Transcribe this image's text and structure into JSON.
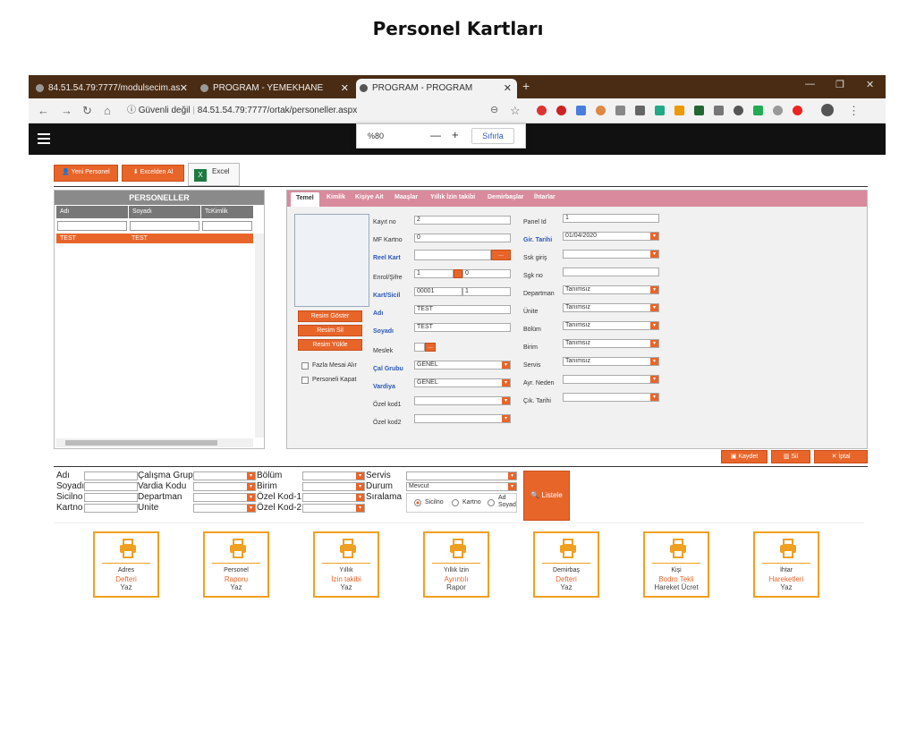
{
  "page_title": "Personel Kartları",
  "browser": {
    "tabs": [
      {
        "label": "84.51.54.79:7777/modulsecim.as"
      },
      {
        "label": "PROGRAM - YEMEKHANE"
      },
      {
        "label": "PROGRAM - PROGRAM"
      }
    ],
    "security": "Güvenli değil",
    "url": "84.51.54.79:7777/ortak/personeller.aspx",
    "zoom_value": "%80",
    "zoom_minus": "—",
    "zoom_plus": "+",
    "zoom_reset": "Sıfırla"
  },
  "toolbar": {
    "new": "Yeni Personel",
    "excel_import": "Excelden Al",
    "excel": "Excel"
  },
  "list": {
    "title": "PERSONELLER",
    "columns": [
      "Adı",
      "Soyadı",
      "TcKimlik"
    ],
    "rows": [
      {
        "adi": "TEST",
        "soyadi": "TEST",
        "tc": ""
      }
    ]
  },
  "detail_tabs": [
    "Temel",
    "Kimlik",
    "Kişiye Ait",
    "Maaşlar",
    "Yıllık İzin takibi",
    "Demirbaşlar",
    "İhtarlar"
  ],
  "photo_buttons": {
    "show": "Resim Göster",
    "delete": "Resim Sil",
    "upload": "Resim Yükle"
  },
  "checks": {
    "overtime": "Fazla Mesai Alır",
    "close": "Personeli Kapat"
  },
  "form": {
    "kayit_no": {
      "label": "Kayıt no",
      "value": "2"
    },
    "mf_kartno": {
      "label": "MF Kartno",
      "value": "0"
    },
    "reel_kart": {
      "label": "Reel Kart",
      "value": ""
    },
    "enrol": {
      "label": "Enrol/Şifre",
      "value1": "1",
      "value2": "0"
    },
    "kart_sicil": {
      "label": "Kart/Sicil",
      "value1": "00001",
      "value2": "1"
    },
    "adi": {
      "label": "Adı",
      "value": "TEST"
    },
    "soyadi": {
      "label": "Soyadı",
      "value": "TEST"
    },
    "meslek": {
      "label": "Meslek",
      "value": ""
    },
    "cal_grubu": {
      "label": "Çal Grubu",
      "value": "GENEL"
    },
    "vardiya": {
      "label": "Vardiya",
      "value": "GENEL"
    },
    "ozel_kod1": {
      "label": "Özel kod1",
      "value": ""
    },
    "ozel_kod2": {
      "label": "Özel kod2",
      "value": ""
    },
    "panel_id": {
      "label": "Panel Id",
      "value": "1"
    },
    "gir_tarihi": {
      "label": "Gir. Tarihi",
      "value": "01/04/2020"
    },
    "ssk_giris": {
      "label": "Ssk giriş",
      "value": ""
    },
    "sgk_no": {
      "label": "Sgk no",
      "value": ""
    },
    "departman": {
      "label": "Departman",
      "value": "Tanımsız"
    },
    "unite": {
      "label": "Ünite",
      "value": "Tanımsız"
    },
    "bolum": {
      "label": "Bölüm",
      "value": "Tanımsız"
    },
    "birim": {
      "label": "Birim",
      "value": "Tanımsız"
    },
    "servis": {
      "label": "Servis",
      "value": "Tanımsız"
    },
    "ayr_neden": {
      "label": "Ayr. Neden",
      "value": ""
    },
    "cik_tarihi": {
      "label": "Çık. Tarihi",
      "value": ""
    }
  },
  "actions": {
    "save": "Kaydet",
    "delete": "Sil",
    "cancel": "İptal"
  },
  "filter": {
    "adi": "Adı",
    "soyadi": "Soyadı",
    "sicilno": "Sicilno",
    "kartno": "Kartno",
    "calisma_grup": "Çalışma Grup",
    "vardia_kodu": "Vardia Kodu",
    "departman": "Departman",
    "unite": "Unite",
    "bolum": "Bölüm",
    "birim": "Birim",
    "ozel_kod1": "Özel Kod-1",
    "ozel_kod2": "Özel Kod-2",
    "servis": "Servis",
    "durum": "Durum",
    "durum_value": "Mevcut",
    "siralama": "Sıralama",
    "sort_sicilno": "Sicilno",
    "sort_kartno": "Kartno",
    "sort_ad": "Ad",
    "sort_soyad": "Soyad",
    "listele": "Listele"
  },
  "reports": [
    {
      "l1": "Adres",
      "l2": "Defteri",
      "l3": "Yaz"
    },
    {
      "l1": "Personel",
      "l2": "Raporu",
      "l3": "Yaz"
    },
    {
      "l1": "Yıllık",
      "l2": "İzin takibi",
      "l3": "Yaz"
    },
    {
      "l1": "Yıllık İzin",
      "l2": "Ayrıntılı",
      "l3": "Rapor"
    },
    {
      "l1": "Demirbaş",
      "l2": "Defteri",
      "l3": "Yaz"
    },
    {
      "l1": "Kişi",
      "l2": "Bodro Tekli",
      "l3": "Hareket Ücret"
    },
    {
      "l1": "İhtar",
      "l2": "Hareketleri",
      "l3": "Yaz"
    }
  ],
  "colors": {
    "accent": "#e8652a",
    "tabbar": "#4a2c14",
    "report_border": "#f0a020",
    "tab_strip": "#d98a9c",
    "label_blue": "#2b58b8"
  }
}
